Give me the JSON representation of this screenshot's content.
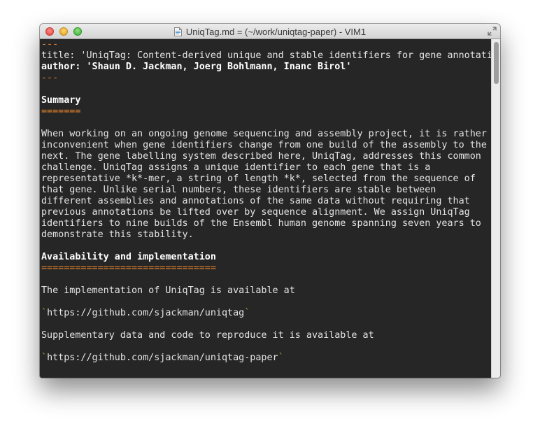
{
  "window": {
    "title": "UniqTag.md = (~/work/uniqtag-paper) - VIM1"
  },
  "editor": {
    "lines": [
      {
        "text": "---",
        "style": "rule"
      },
      {
        "text": "title: 'UniqTag: Content-derived unique and stable identifiers for gene annotati",
        "style": "normal"
      },
      {
        "text": "author: 'Shaun D. Jackman, Joerg Bohlmann, Inanc Birol'",
        "style": "bold"
      },
      {
        "text": "---",
        "style": "rule"
      },
      {
        "text": "",
        "style": "normal"
      },
      {
        "text": "Summary",
        "style": "bold"
      },
      {
        "text": "=======",
        "style": "rule"
      },
      {
        "text": "",
        "style": "normal"
      },
      {
        "text": "When working on an ongoing genome sequencing and assembly project, it is rather",
        "style": "normal"
      },
      {
        "text": "inconvenient when gene identifiers change from one build of the assembly to the",
        "style": "normal"
      },
      {
        "text": "next. The gene labelling system described here, UniqTag, addresses this common",
        "style": "normal"
      },
      {
        "text": "challenge. UniqTag assigns a unique identifier to each gene that is a",
        "style": "normal"
      },
      {
        "text": "representative *k*-mer, a string of length *k*, selected from the sequence of",
        "style": "normal"
      },
      {
        "text": "that gene. Unlike serial numbers, these identifiers are stable between",
        "style": "normal"
      },
      {
        "text": "different assemblies and annotations of the same data without requiring that",
        "style": "normal"
      },
      {
        "text": "previous annotations be lifted over by sequence alignment. We assign UniqTag",
        "style": "normal"
      },
      {
        "text": "identifiers to nine builds of the Ensembl human genome spanning seven years to",
        "style": "normal"
      },
      {
        "text": "demonstrate this stability.",
        "style": "normal"
      },
      {
        "text": "",
        "style": "normal"
      },
      {
        "text": "Availability and implementation",
        "style": "bold"
      },
      {
        "text": "===============================",
        "style": "rule"
      },
      {
        "text": "",
        "style": "normal"
      },
      {
        "text": "The implementation of UniqTag is available at",
        "style": "normal"
      },
      {
        "text": "",
        "style": "normal"
      },
      {
        "text": "https://github.com/sjackman/uniqtag",
        "style": "code"
      },
      {
        "text": "",
        "style": "normal"
      },
      {
        "text": "Supplementary data and code to reproduce it is available at",
        "style": "normal"
      },
      {
        "text": "",
        "style": "normal"
      },
      {
        "text": "https://github.com/sjackman/uniqtag-paper",
        "style": "code"
      }
    ]
  },
  "colors": {
    "background": "#262626",
    "text": "#e4e4e4",
    "heading": "#ffffff",
    "rule": "#e8862c",
    "code_tick": "#7fbf3f"
  },
  "icons": {
    "close": "close-icon",
    "minimize": "minimize-icon",
    "zoom": "zoom-icon",
    "document": "markdown-document-icon",
    "fullscreen": "fullscreen-arrows-icon"
  }
}
